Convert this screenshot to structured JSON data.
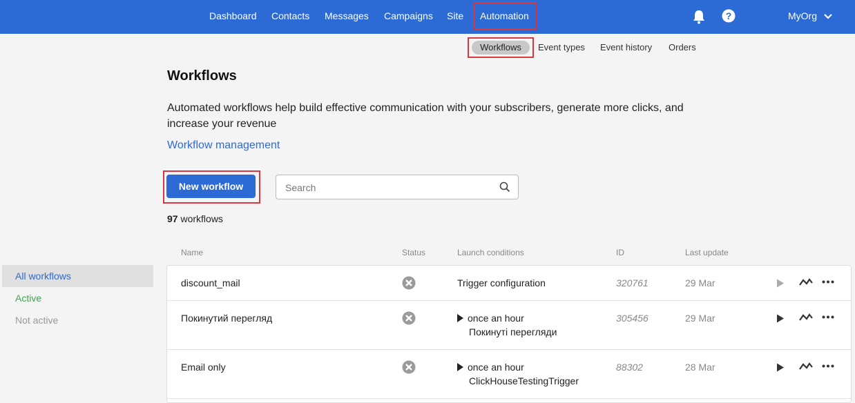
{
  "topnav": {
    "items": [
      {
        "label": "Dashboard"
      },
      {
        "label": "Contacts"
      },
      {
        "label": "Messages"
      },
      {
        "label": "Campaigns"
      },
      {
        "label": "Site"
      },
      {
        "label": "Automation"
      }
    ],
    "active": "Automation",
    "org": "MyOrg",
    "icons": [
      "bell-icon",
      "help-icon",
      "chevron-down-icon"
    ]
  },
  "subnav": {
    "items": [
      {
        "label": "Workflows"
      },
      {
        "label": "Event types"
      },
      {
        "label": "Event history"
      },
      {
        "label": "Orders"
      }
    ]
  },
  "page": {
    "title": "Workflows",
    "description": "Automated workflows help build effective communication with your subscribers, generate more clicks, and increase your revenue",
    "management_link": "Workflow management",
    "new_button": "New workflow",
    "search_placeholder": "Search",
    "count": "97",
    "count_label": "workflows"
  },
  "sidebar": {
    "items": [
      {
        "label": "All workflows"
      },
      {
        "label": "Active"
      },
      {
        "label": "Not active"
      }
    ]
  },
  "table": {
    "headers": {
      "name": "Name",
      "status": "Status",
      "launch": "Launch conditions",
      "id": "ID",
      "updated": "Last update"
    },
    "rows": [
      {
        "name": "discount_mail",
        "launch_text": "",
        "launch_link": "Trigger configuration",
        "id": "320761",
        "updated": "29 Mar"
      },
      {
        "name": "Покинутий перегляд",
        "launch_text": "once an hour",
        "launch_link": "Покинуті перегляди",
        "id": "305456",
        "updated": "29 Mar"
      },
      {
        "name": "Email only",
        "launch_text": "once an hour",
        "launch_link": "ClickHouseTestingTrigger",
        "id": "88302",
        "updated": "28 Mar"
      }
    ]
  },
  "colors": {
    "brand": "#2c6ad6",
    "highlight": "#d9373f",
    "active_green": "#3ea352"
  }
}
